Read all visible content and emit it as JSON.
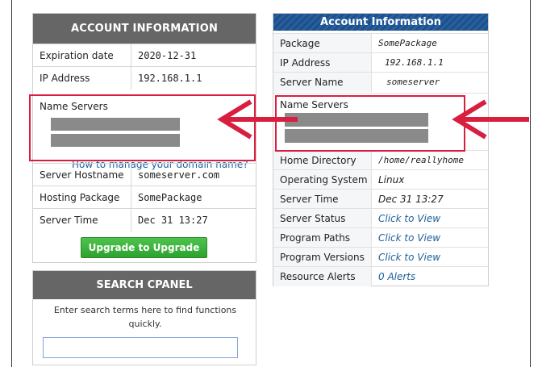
{
  "account_info_left": {
    "title": "ACCOUNT INFORMATION",
    "rows": [
      {
        "label": "Expiration date",
        "value": "2020-12-31"
      },
      {
        "label": "IP Address",
        "value": "192.168.1.1"
      }
    ],
    "name_servers_label": "Name Servers",
    "manage_link": "How to manage your domain name?",
    "rows_after": [
      {
        "label": "Server Hostname",
        "value": "someserver.com"
      },
      {
        "label": "Hosting Package",
        "value": "SomePackage"
      },
      {
        "label": "Server Time",
        "value": "Dec 31 13:27"
      }
    ],
    "upgrade_button": "Upgrade to Upgrade"
  },
  "search_cpanel": {
    "title": "SEARCH CPANEL",
    "description": "Enter search terms here to find functions quickly.",
    "input_value": "",
    "input_placeholder": ""
  },
  "account_info_right": {
    "title": "Account Information",
    "rows_top": [
      {
        "label": "Package",
        "value": "SomePackage"
      },
      {
        "label": "IP Address",
        "value": "192.168.1.1"
      },
      {
        "label": "Server Name",
        "value": "someserver"
      }
    ],
    "name_servers_label": "Name Servers",
    "rows_bottom": [
      {
        "label": "Home Directory",
        "value": "/home/reallyhome"
      },
      {
        "label": "Operating System",
        "value": "Linux"
      },
      {
        "label": "Server Time",
        "value": "Dec 31 13:27"
      },
      {
        "label": "Server Status",
        "value": "Click to View"
      },
      {
        "label": "Program Paths",
        "value": "Click to View"
      },
      {
        "label": "Program Versions",
        "value": "Click to View"
      },
      {
        "label": "Resource Alerts",
        "value": "0 Alerts"
      }
    ]
  },
  "colors": {
    "highlight": "#d81f3f",
    "header_gray": "#666666",
    "header_blue": "#1e4f8a",
    "link": "#1d5f98",
    "button_green": "#3cb33c"
  }
}
